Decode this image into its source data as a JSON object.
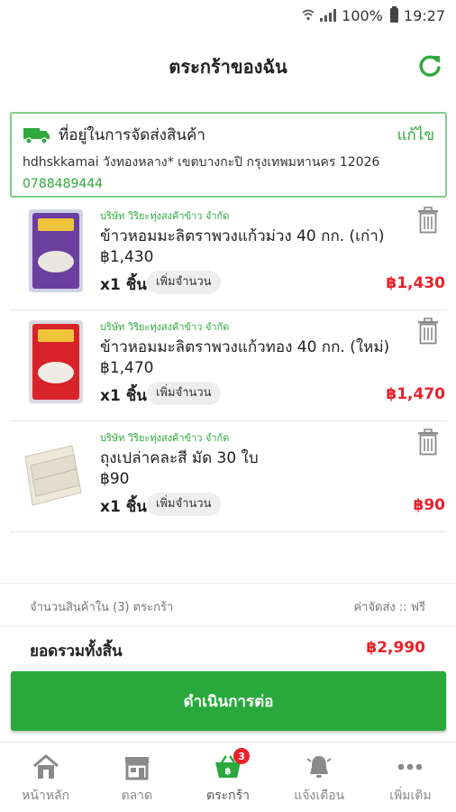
{
  "status_bar": {
    "battery": "100%",
    "time": "19:27"
  },
  "header": {
    "title": "ตระกร้าของฉัน"
  },
  "address": {
    "title": "ที่อยู่ในการจัดส่งสินค้า",
    "edit_label": "แก้ไข",
    "line": "hdhskkamai วังทองหลาง* เขตบางกะปิ กรุงเทพมหานคร 12026",
    "phone": "0788489444"
  },
  "cart": {
    "items": [
      {
        "seller": "บริษัท วิริยะทุ่งสงค้าข้าว จำกัด",
        "name": "ข้าวหอมมะลิตราพวงแก้วม่วง 40 กก. (เก่า)",
        "price": "฿1,430",
        "qty": "x1 ชิ้น",
        "add_qty_label": "เพิ่มจำนวน",
        "total": "฿1,430",
        "bag_color": "#6a3fa0"
      },
      {
        "seller": "บริษัท วิริยะทุ่งสงค้าข้าว จำกัด",
        "name": "ข้าวหอมมะลิตราพวงแก้วทอง 40 กก. (ใหม่)",
        "price": "฿1,470",
        "qty": "x1 ชิ้น",
        "add_qty_label": "เพิ่มจำนวน",
        "total": "฿1,470",
        "bag_color": "#d8232a"
      },
      {
        "seller": "บริษัท วิริยะทุ่งสงค้าข้าว จำกัด",
        "name": "ถุงเปล่าคละสี มัด 30 ใบ",
        "price": "฿90",
        "qty": "x1 ชิ้น",
        "add_qty_label": "เพิ่มจำนวน",
        "total": "฿90",
        "bag_color": "#ece8da"
      }
    ]
  },
  "summary": {
    "count_label": "จำนวนสินค้าใน (3) ตระกร้า",
    "shipping_label": "ค่าจัดส่ง :: ฟรี",
    "grand_total_label": "ยอดรวมทั้งสิ้น",
    "grand_total_value": "฿2,990"
  },
  "checkout_label": "ดำเนินการต่อ",
  "nav": {
    "home": "หน้าหลัก",
    "market": "ตลาด",
    "cart": "ตระกร้า",
    "cart_badge": "3",
    "notifications": "แจ้งเตือน",
    "more": "เพิ่มเติม"
  },
  "colors": {
    "accent": "#29a93b",
    "price_red": "#e8212b",
    "border_green": "#7fcf8c"
  }
}
